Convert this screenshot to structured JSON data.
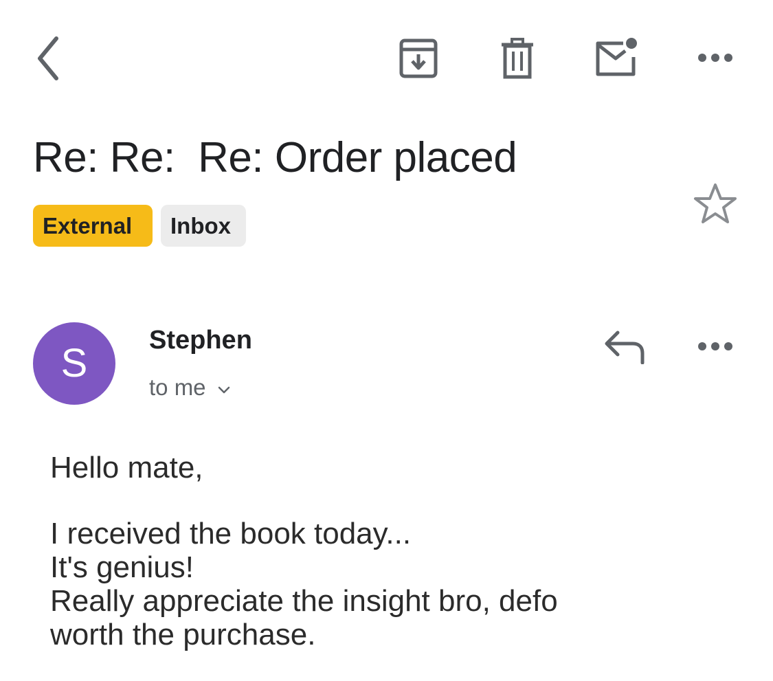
{
  "toolbar": {
    "back_icon": "chevron-left-icon",
    "archive_icon": "archive-icon",
    "delete_icon": "trash-icon",
    "mark_unread_icon": "mail-unread-icon",
    "more_icon": "more-horizontal-icon"
  },
  "email": {
    "subject": "Re: Re:  Re: Order placed",
    "labels": [
      {
        "text": "External",
        "color": "#f6bb18"
      },
      {
        "text": "Inbox",
        "color": "#ececec"
      }
    ],
    "starred": false
  },
  "message": {
    "sender": {
      "name": "Stephen",
      "avatar_initial": "S",
      "avatar_color": "#7e57c2"
    },
    "recipient_text": "to me",
    "body": {
      "greeting": "Hello mate,",
      "lines": [
        "I received the book today...",
        "It's genius!",
        "Really appreciate the insight bro, defo",
        "worth the purchase."
      ]
    }
  },
  "colors": {
    "icon_gray": "#5f6368",
    "text_primary": "#202124",
    "accent_external": "#f6bb18"
  }
}
